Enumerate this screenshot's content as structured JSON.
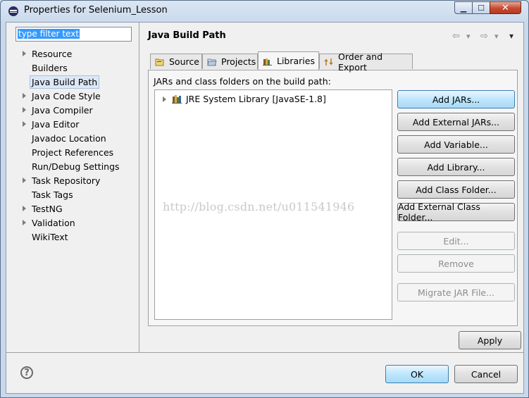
{
  "window": {
    "title": "Properties for Selenium_Lesson",
    "minimize": "▁",
    "maximize": "☐",
    "close": "✕"
  },
  "filter": {
    "text": "type filter text"
  },
  "tree": [
    {
      "label": "Resource",
      "expandable": true
    },
    {
      "label": "Builders",
      "expandable": false
    },
    {
      "label": "Java Build Path",
      "expandable": false,
      "selected": true
    },
    {
      "label": "Java Code Style",
      "expandable": true
    },
    {
      "label": "Java Compiler",
      "expandable": true
    },
    {
      "label": "Java Editor",
      "expandable": true
    },
    {
      "label": "Javadoc Location",
      "expandable": false
    },
    {
      "label": "Project References",
      "expandable": false
    },
    {
      "label": "Run/Debug Settings",
      "expandable": false
    },
    {
      "label": "Task Repository",
      "expandable": true
    },
    {
      "label": "Task Tags",
      "expandable": false
    },
    {
      "label": "TestNG",
      "expandable": true
    },
    {
      "label": "Validation",
      "expandable": true
    },
    {
      "label": "WikiText",
      "expandable": false
    }
  ],
  "page": {
    "title": "Java Build Path",
    "nav": {
      "back": "⇦",
      "back_menu": "▾",
      "forward": "⇨",
      "forward_menu": "▾",
      "view_menu": "▾"
    }
  },
  "tabs": [
    {
      "label": "Source",
      "icon": "source-folder-icon"
    },
    {
      "label": "Projects",
      "icon": "projects-icon"
    },
    {
      "label": "Libraries",
      "icon": "libraries-icon",
      "active": true
    },
    {
      "label": "Order and Export",
      "icon": "order-export-icon"
    }
  ],
  "libraries": {
    "heading": "JARs and class folders on the build path:",
    "items": [
      {
        "label": "JRE System Library [JavaSE-1.8]"
      }
    ],
    "watermark": "http://blog.csdn.net/u011541946"
  },
  "buttons": {
    "add_jars": "Add JARs...",
    "add_external_jars": "Add External JARs...",
    "add_variable": "Add Variable...",
    "add_library": "Add Library...",
    "add_class_folder": "Add Class Folder...",
    "add_external_class_folder": "Add External Class Folder...",
    "edit": "Edit...",
    "remove": "Remove",
    "migrate_jar": "Migrate JAR File...",
    "apply": "Apply",
    "ok": "OK",
    "cancel": "Cancel",
    "help": "?"
  },
  "colors": {
    "titlebar": "#c9d9ec",
    "selection": "#3399ff",
    "focus_button": "#bee6fd",
    "close_button": "#c54a2f"
  }
}
